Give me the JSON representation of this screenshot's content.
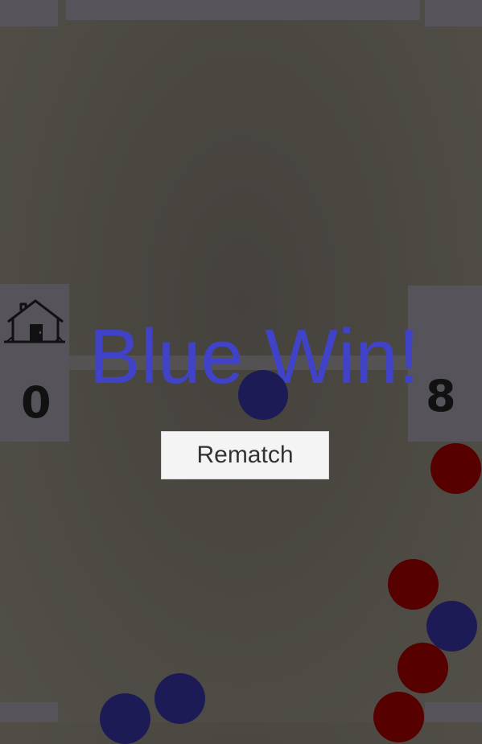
{
  "game": {
    "result_text": "Blue Win!",
    "rematch_label": "Rematch"
  },
  "scores": {
    "left": "0",
    "right": "8"
  },
  "icons": {
    "home": "home-icon"
  },
  "colors": {
    "win_text": "#4043c8",
    "blue_ball": "#1d1b56",
    "red_ball": "#560000",
    "panel": "#56545a"
  }
}
